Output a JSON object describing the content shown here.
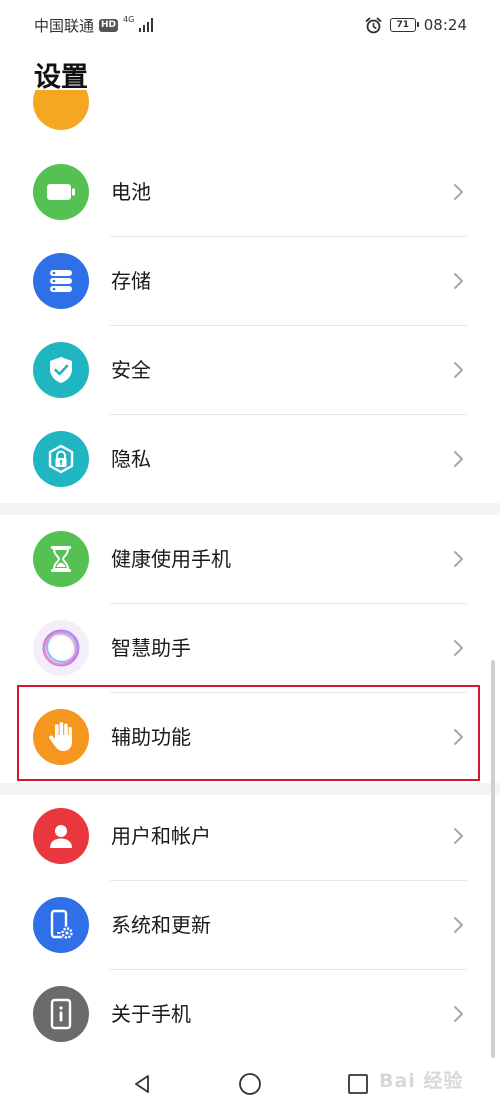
{
  "status_bar": {
    "carrier": "中国联通",
    "hd": "HD",
    "network": "4G",
    "battery": "71",
    "time": "08:24"
  },
  "header": {
    "title": "设置"
  },
  "settings": [
    {
      "label": "电池",
      "icon": "battery-icon",
      "color": "#55c152"
    },
    {
      "label": "存储",
      "icon": "storage-icon",
      "color": "#2f6fe8"
    },
    {
      "label": "安全",
      "icon": "shield-check-icon",
      "color": "#1fb6c2"
    },
    {
      "label": "隐私",
      "icon": "privacy-lock-icon",
      "color": "#1fb6c2"
    },
    {
      "label": "健康使用手机",
      "icon": "hourglass-icon",
      "color": "#55c152"
    },
    {
      "label": "智慧助手",
      "icon": "smart-assistant-icon",
      "color": "#f3eefa"
    },
    {
      "label": "辅助功能",
      "icon": "hand-icon",
      "color": "#f5961e"
    },
    {
      "label": "用户和帐户",
      "icon": "user-icon",
      "color": "#e8383d"
    },
    {
      "label": "系统和更新",
      "icon": "phone-settings-icon",
      "color": "#2f6fe8"
    },
    {
      "label": "关于手机",
      "icon": "phone-info-icon",
      "color": "#6b6b6b"
    }
  ],
  "nav": {
    "back": "back-icon",
    "home": "home-icon",
    "recents": "recents-icon"
  },
  "watermark": {
    "text": "Bai 经验"
  }
}
